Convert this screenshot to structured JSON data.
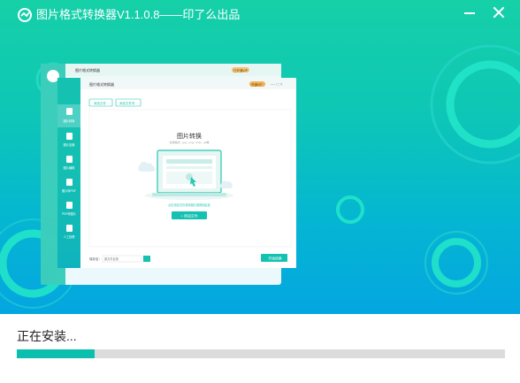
{
  "window": {
    "title": "图片格式转换器V1.1.0.8——印了么出品"
  },
  "illustration": {
    "back_window_title": "图片格式转换器",
    "back_window_badge": "已开通VIP",
    "front_window_title": "图片格式转换器",
    "front_window_badge": "开通VIP",
    "sidebar_items": [
      "图片转换",
      "图片压缩",
      "图片编辑",
      "图片转PDF",
      "PDF转图片",
      "人工处理"
    ],
    "tool_add_file": "添加文件",
    "tool_add_folder": "添加文件夹",
    "panel_title": "图片转换",
    "panel_subtitle": "支持格式：jpg、png、bmp、gif等",
    "drop_hint": "点击添加文件或将图片拖拽到此处",
    "add_button": "+ 添加文件",
    "save_label": "保存至：",
    "save_path": "原文件目录",
    "start_button": "开始转换"
  },
  "install": {
    "status": "正在安装...",
    "progress": 0.16
  },
  "colors": {
    "accent": "#0bbfae",
    "track": "#dcdcdc",
    "banner_top": "#16d0a8",
    "banner_bottom": "#04a6e0"
  }
}
